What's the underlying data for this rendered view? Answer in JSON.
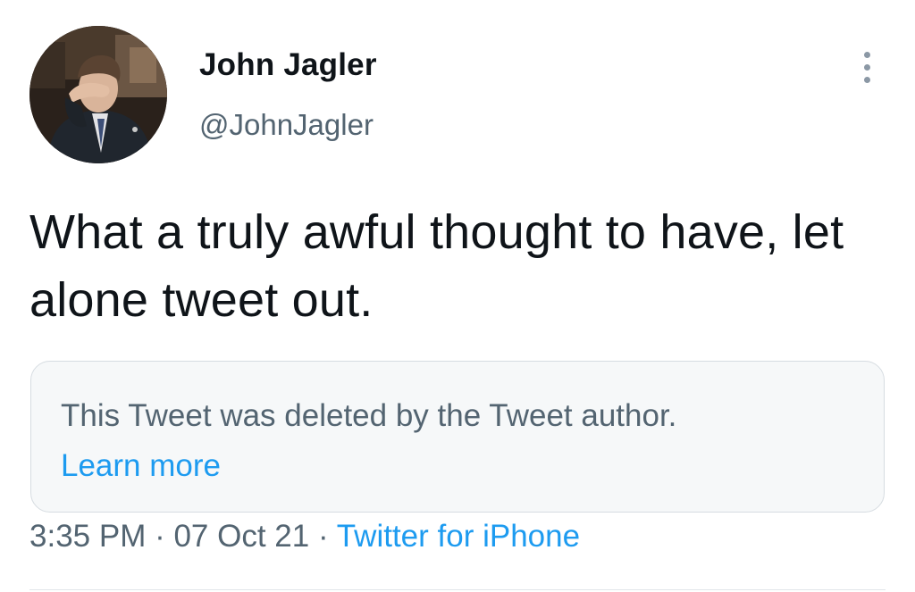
{
  "tweet": {
    "author": {
      "display_name": "John Jagler",
      "handle": "@JohnJagler"
    },
    "text": "What a truly awful thought to have, let alone tweet out.",
    "quoted": {
      "message": "This Tweet was deleted by the Tweet author.",
      "link_label": "Learn more"
    },
    "time": "3:35 PM",
    "separator": " · ",
    "date": "07 Oct 21",
    "source": "Twitter for iPhone"
  },
  "icons": {
    "more": "more-vertical-icon",
    "avatar": "profile-photo"
  },
  "colors": {
    "primary_text": "#0f1419",
    "secondary_text": "#536471",
    "link": "#1d9bf0",
    "quote_background": "#f6f8f9",
    "quote_border": "#d6dce1"
  }
}
